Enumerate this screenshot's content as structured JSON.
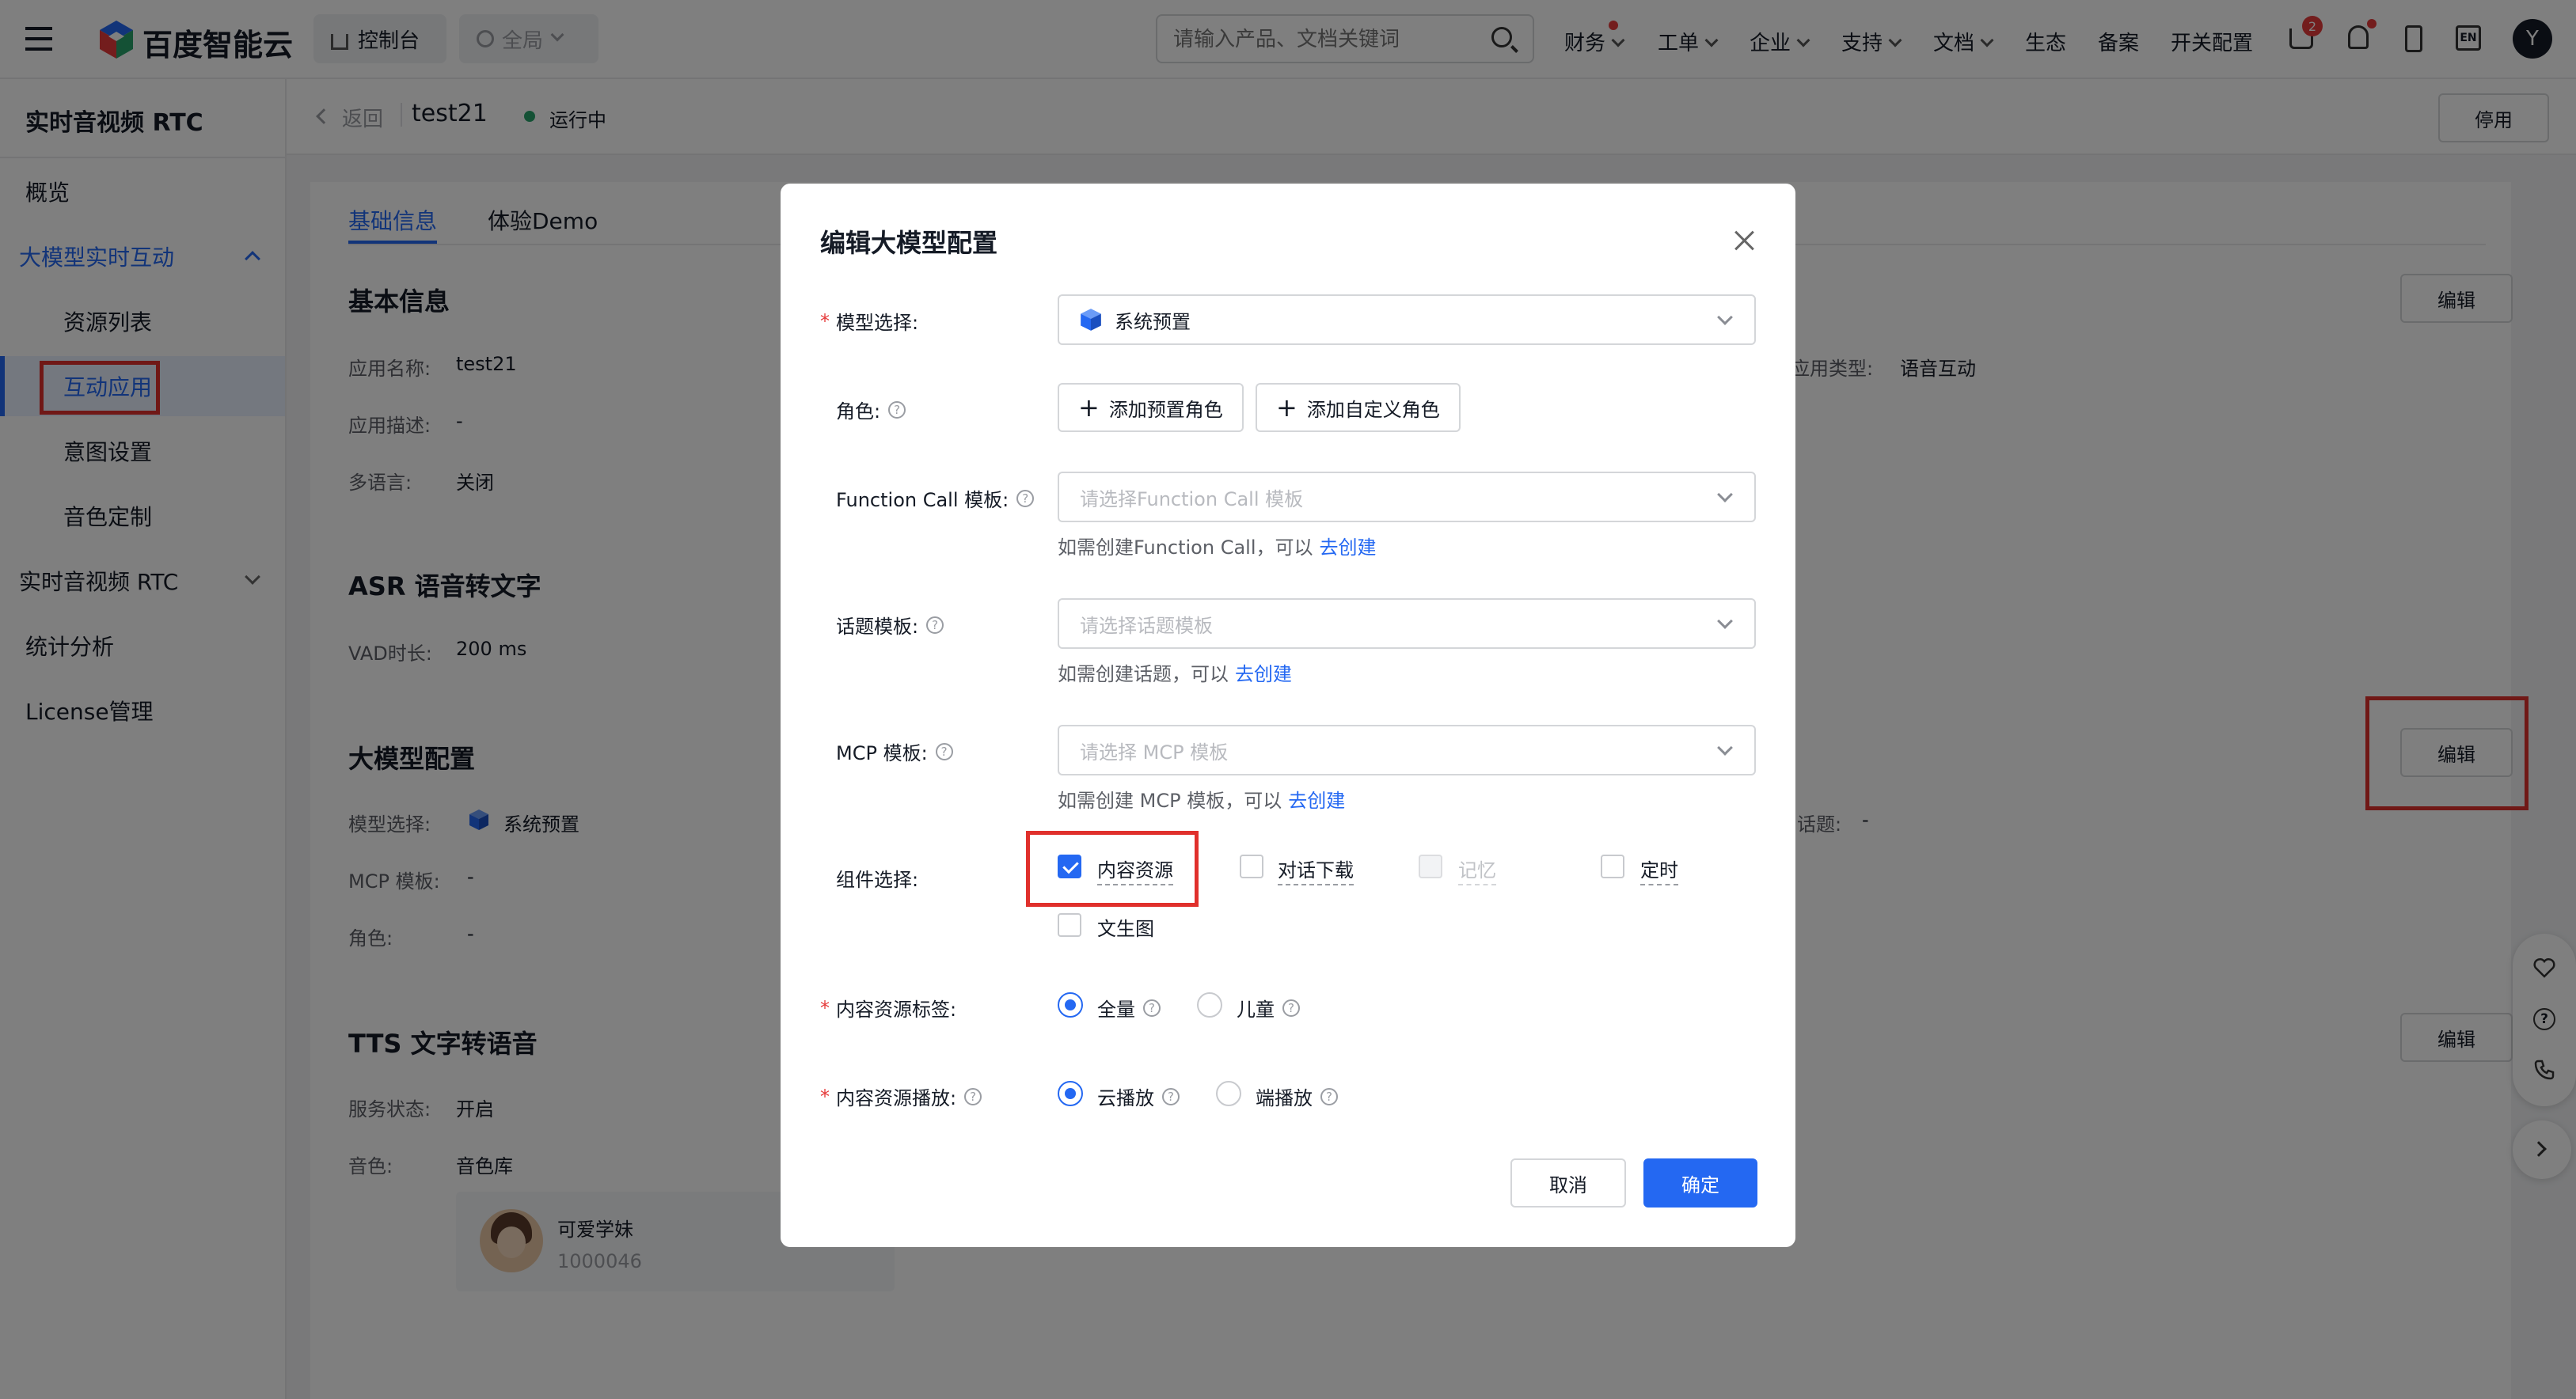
{
  "topnav": {
    "logo_text": "百度智能云",
    "console_label": "控制台",
    "region_label": "全局",
    "search_placeholder": "请输入产品、文档关键词",
    "menu": {
      "finance": "财务",
      "ticket": "工单",
      "enterprise": "企业",
      "support": "支持",
      "docs": "文档",
      "ecosystem": "生态",
      "filing": "备案",
      "switch_config": "开关配置"
    },
    "cart_badge": "2",
    "lang_label": "EN",
    "avatar_letter": "Y"
  },
  "sidebar": {
    "title": "实时音视频 RTC",
    "items": {
      "overview": "概览",
      "llm_interaction": "大模型实时互动",
      "resource_list": "资源列表",
      "interactive_app": "互动应用",
      "intent_settings": "意图设置",
      "voice_custom": "音色定制",
      "rtc": "实时音视频 RTC",
      "stats": "统计分析",
      "license": "License管理"
    }
  },
  "header": {
    "back": "返回",
    "app_name": "test21",
    "status": "运行中",
    "stop": "停用"
  },
  "tabs": {
    "basic": "基础信息",
    "demo": "体验Demo"
  },
  "basic_info": {
    "title": "基本信息",
    "name_label": "应用名称:",
    "name_value": "test21",
    "desc_label": "应用描述:",
    "desc_value": "-",
    "multilang_label": "多语言:",
    "multilang_value": "关闭",
    "type_label": "应用类型:",
    "type_value": "语音互动",
    "edit": "编辑"
  },
  "asr": {
    "title": "ASR 语音转文字",
    "vad_label": "VAD时长:",
    "vad_value": "200 ms"
  },
  "llm": {
    "title": "大模型配置",
    "model_label": "模型选择:",
    "model_value": "系统预置",
    "mcp_label": "MCP 模板:",
    "mcp_value": "-",
    "role_label": "角色:",
    "role_value": "-",
    "topic_label": "话题:",
    "topic_value": "-",
    "edit": "编辑"
  },
  "tts": {
    "title": "TTS 文字转语音",
    "service_label": "服务状态:",
    "service_value": "开启",
    "voice_label": "音色:",
    "voice_value": "音色库",
    "voice_name": "可爱学妹",
    "voice_id": "1000046",
    "edit": "编辑"
  },
  "modal": {
    "title": "编辑大模型配置",
    "model_label": "模型选择:",
    "model_value": "系统预置",
    "role_label": "角色:",
    "add_preset_role": "添加预置角色",
    "add_custom_role": "添加自定义角色",
    "fc_label": "Function Call 模板:",
    "fc_placeholder": "请选择Function Call 模板",
    "fc_hint": "如需创建Function Call，可以",
    "topic_label": "话题模板:",
    "topic_placeholder": "请选择话题模板",
    "topic_hint": "如需创建话题，可以",
    "mcp_label": "MCP 模板:",
    "mcp_placeholder": "请选择 MCP 模板",
    "mcp_hint": "如需创建 MCP 模板，可以",
    "create_link": "去创建",
    "components_label": "组件选择:",
    "components": {
      "content": "内容资源",
      "dialog_download": "对话下载",
      "memory": "记忆",
      "timer": "定时",
      "text2img": "文生图"
    },
    "content_tag_label": "内容资源标签:",
    "tag_all": "全量",
    "tag_child": "儿童",
    "play_label": "内容资源播放:",
    "play_cloud": "云播放",
    "play_device": "端播放",
    "cancel": "取消",
    "confirm": "确定"
  }
}
